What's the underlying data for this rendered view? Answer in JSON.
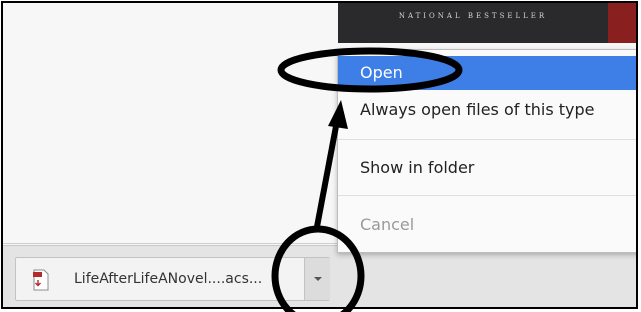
{
  "page": {
    "cover_text": "NATIONAL BESTSELLER"
  },
  "download_bar": {
    "file_name": "LifeAfterLifeANovel....acs...",
    "file_icon": "pdf-file-icon",
    "dropdown_icon": "chevron-down-icon"
  },
  "context_menu": {
    "items": [
      {
        "label": "Open",
        "highlighted": true,
        "disabled": false
      },
      {
        "label": "Always open files of this type",
        "highlighted": false,
        "disabled": false
      },
      {
        "label": "Show in folder",
        "highlighted": false,
        "disabled": false
      },
      {
        "label": "Cancel",
        "highlighted": false,
        "disabled": true
      }
    ]
  },
  "colors": {
    "highlight": "#3d7fe6",
    "annotation": "#000000"
  }
}
